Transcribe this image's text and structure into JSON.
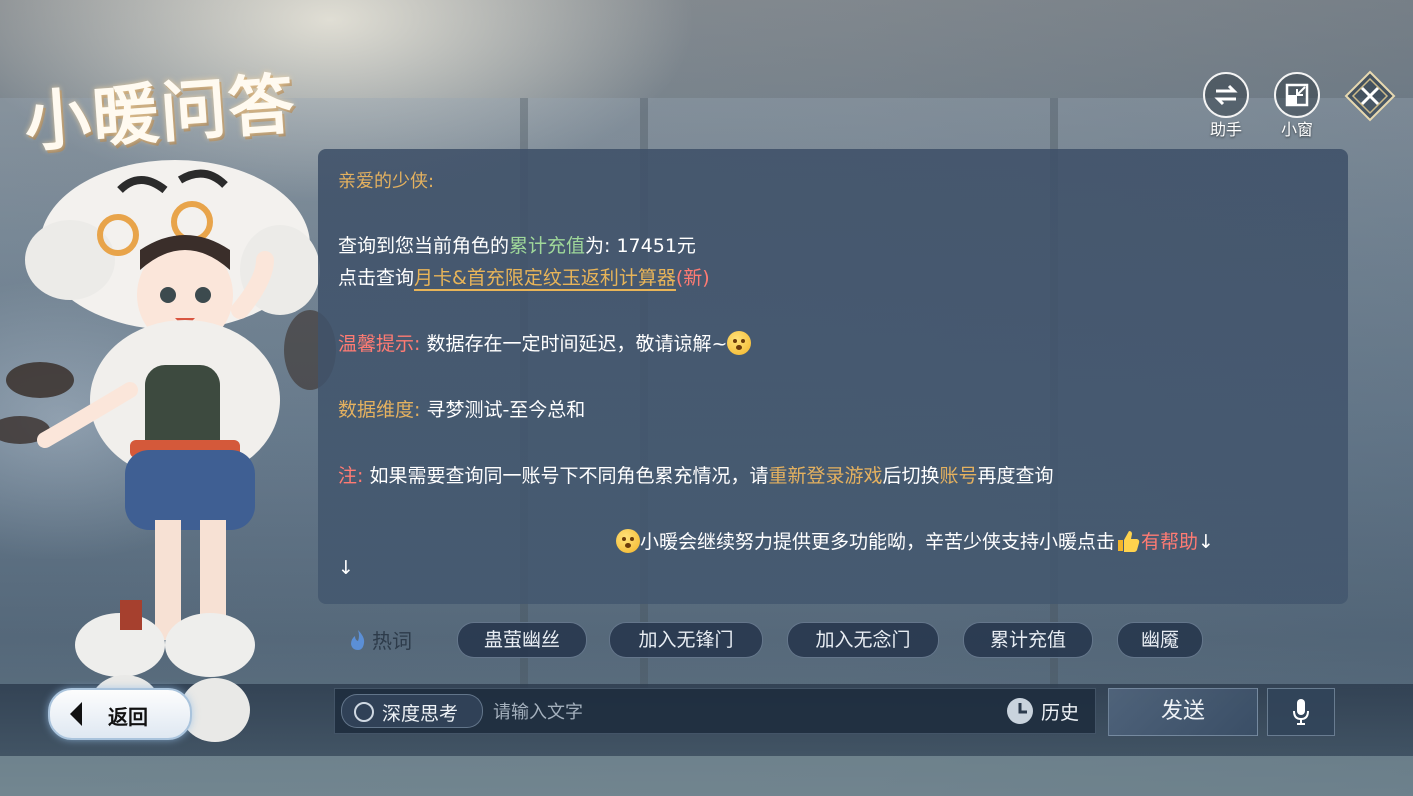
{
  "header": {
    "title": "小暖问答",
    "assistant_label": "助手",
    "mini_window_label": "小窗"
  },
  "message": {
    "greeting": "亲爱的少侠:",
    "recharge_prefix": "查询到您当前角色的",
    "recharge_keyword": "累计充值",
    "recharge_suffix": "为: 17451元",
    "calc_prefix": "点击查询",
    "calc_link": "月卡&首充限定纹玉返利计算器",
    "calc_new": "(新)",
    "tip_label": "温馨提示:",
    "tip_text": " 数据存在一定时间延迟，敬请谅解~",
    "dimension_label": "数据维度:",
    "dimension_text": " 寻梦测试-至今总和",
    "note_label": "注:",
    "note_text1": " 如果需要查询同一账号下不同角色累充情况，请",
    "note_keyword1": "重新登录游戏",
    "note_text2": "后切换",
    "note_keyword2": "账号",
    "note_text3": "再度查询",
    "footer_text": "小暖会继续努力提供更多功能呦，辛苦少侠支持小暖点击",
    "helpful_label": "有帮助",
    "arrow_down": "↓"
  },
  "hot_words": {
    "label": "热词",
    "items": [
      "蛊萤幽丝",
      "加入无锋门",
      "加入无念门",
      "累计充值",
      "幽魇"
    ]
  },
  "bottom": {
    "back_label": "返回",
    "deep_think_label": "深度思考",
    "input_placeholder": "请输入文字",
    "input_value": "",
    "history_label": "历史",
    "send_label": "发送"
  },
  "icons": {
    "assistant": "swap-icon",
    "mini_window": "mini-window-icon",
    "close": "close-icon",
    "fire": "fire-icon",
    "history": "clock-icon",
    "mic": "microphone-icon",
    "back": "back-arrow-icon"
  },
  "colors": {
    "gold": "#e4b15f",
    "green": "#9fd89a",
    "red": "#ff7b73",
    "panel": "#3e5068"
  }
}
